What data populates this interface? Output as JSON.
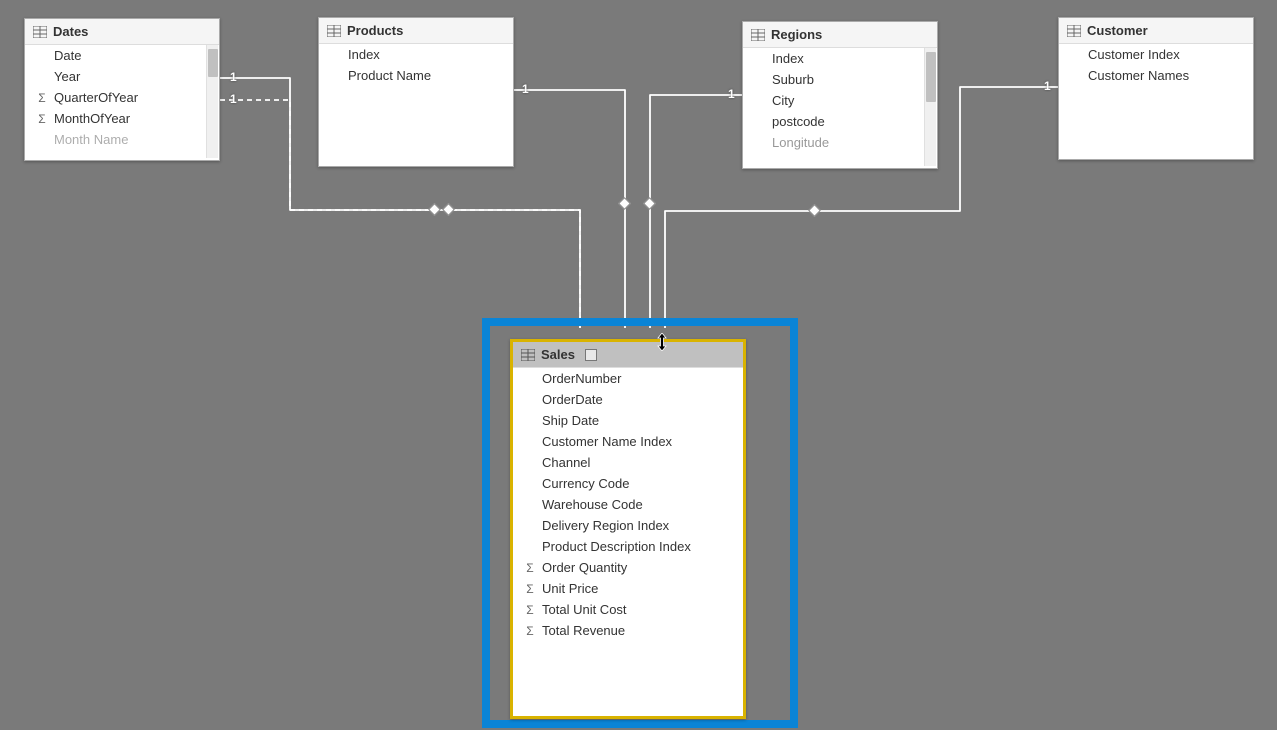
{
  "tables": {
    "dates": {
      "title": "Dates",
      "fields": [
        {
          "name": "Date",
          "agg": false
        },
        {
          "name": "Year",
          "agg": false
        },
        {
          "name": "QuarterOfYear",
          "agg": true
        },
        {
          "name": "MonthOfYear",
          "agg": true
        },
        {
          "name": "Month Name",
          "agg": false
        }
      ]
    },
    "products": {
      "title": "Products",
      "fields": [
        {
          "name": "Index",
          "agg": false
        },
        {
          "name": "Product Name",
          "agg": false
        }
      ]
    },
    "regions": {
      "title": "Regions",
      "fields": [
        {
          "name": "Index",
          "agg": false
        },
        {
          "name": "Suburb",
          "agg": false
        },
        {
          "name": "City",
          "agg": false
        },
        {
          "name": "postcode",
          "agg": false
        },
        {
          "name": "Longitude",
          "agg": false
        }
      ]
    },
    "customer": {
      "title": "Customer",
      "fields": [
        {
          "name": "Customer Index",
          "agg": false
        },
        {
          "name": "Customer Names",
          "agg": false
        }
      ]
    },
    "sales": {
      "title": "Sales",
      "fields": [
        {
          "name": "OrderNumber",
          "agg": false
        },
        {
          "name": "OrderDate",
          "agg": false
        },
        {
          "name": "Ship Date",
          "agg": false
        },
        {
          "name": "Customer Name Index",
          "agg": false
        },
        {
          "name": "Channel",
          "agg": false
        },
        {
          "name": "Currency Code",
          "agg": false
        },
        {
          "name": "Warehouse Code",
          "agg": false
        },
        {
          "name": "Delivery Region Index",
          "agg": false
        },
        {
          "name": "Product Description Index",
          "agg": false
        },
        {
          "name": "Order Quantity",
          "agg": true
        },
        {
          "name": "Unit Price",
          "agg": true
        },
        {
          "name": "Total Unit Cost",
          "agg": true
        },
        {
          "name": "Total Revenue",
          "agg": true
        }
      ]
    }
  },
  "relationships": {
    "dates_sales_1": {
      "cardinality_from": "1"
    },
    "dates_sales_2": {
      "cardinality_from": "1"
    },
    "products_sales": {
      "cardinality_from": "1"
    },
    "regions_sales": {
      "cardinality_from": "1"
    },
    "customer_sales": {
      "cardinality_from": "1"
    }
  },
  "sigma": "Σ"
}
